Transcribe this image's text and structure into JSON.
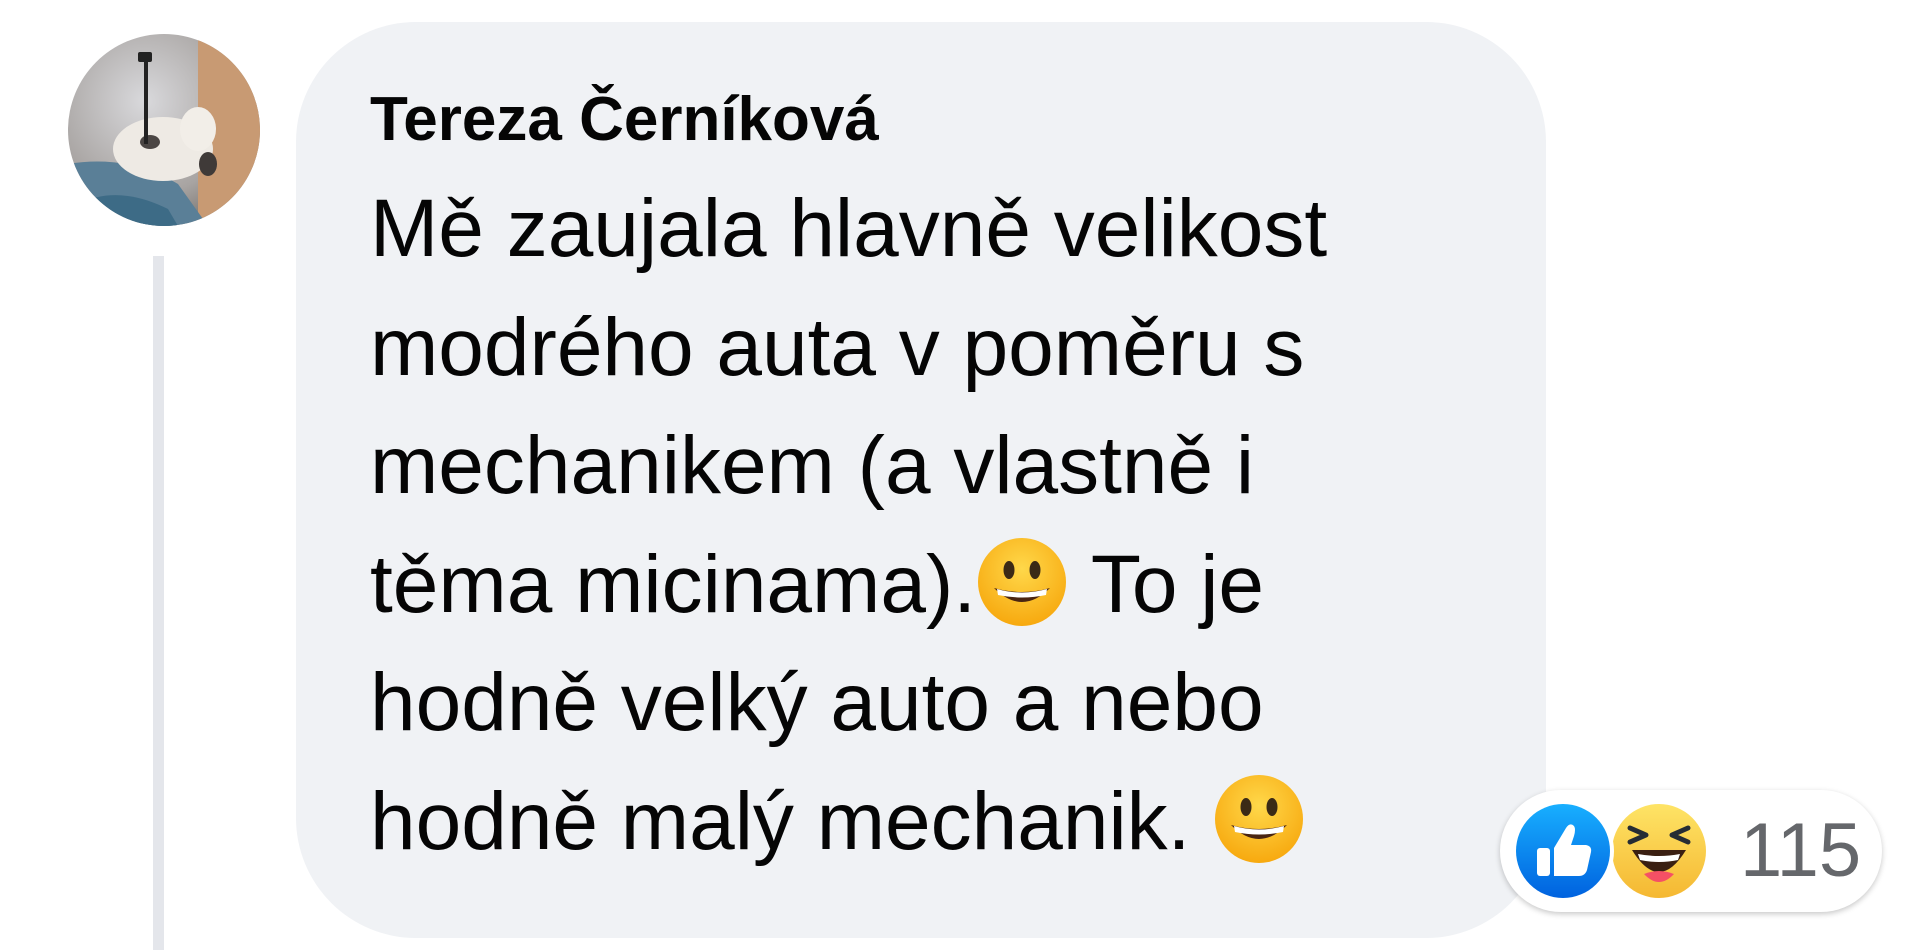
{
  "comment": {
    "author": "Tereza Černíková",
    "lines": [
      "Mě zaujala hlavně velikost",
      "modrého auta v poměru s",
      "mechanikem (a vlastně i",
      "těma micinama).",
      "To je",
      "hodně velký auto a nebo",
      "hodně malý mechanik."
    ],
    "inline_emojis": [
      "grinning-face-emoji",
      "grinning-face-emoji"
    ]
  },
  "reactions": {
    "types": [
      "like-icon",
      "haha-icon"
    ],
    "count": "115"
  },
  "colors": {
    "bubble": "#f0f2f5",
    "text": "#050505",
    "count": "#65676b",
    "like_blue": "#1877f2",
    "thread_line": "#e4e6eb"
  }
}
